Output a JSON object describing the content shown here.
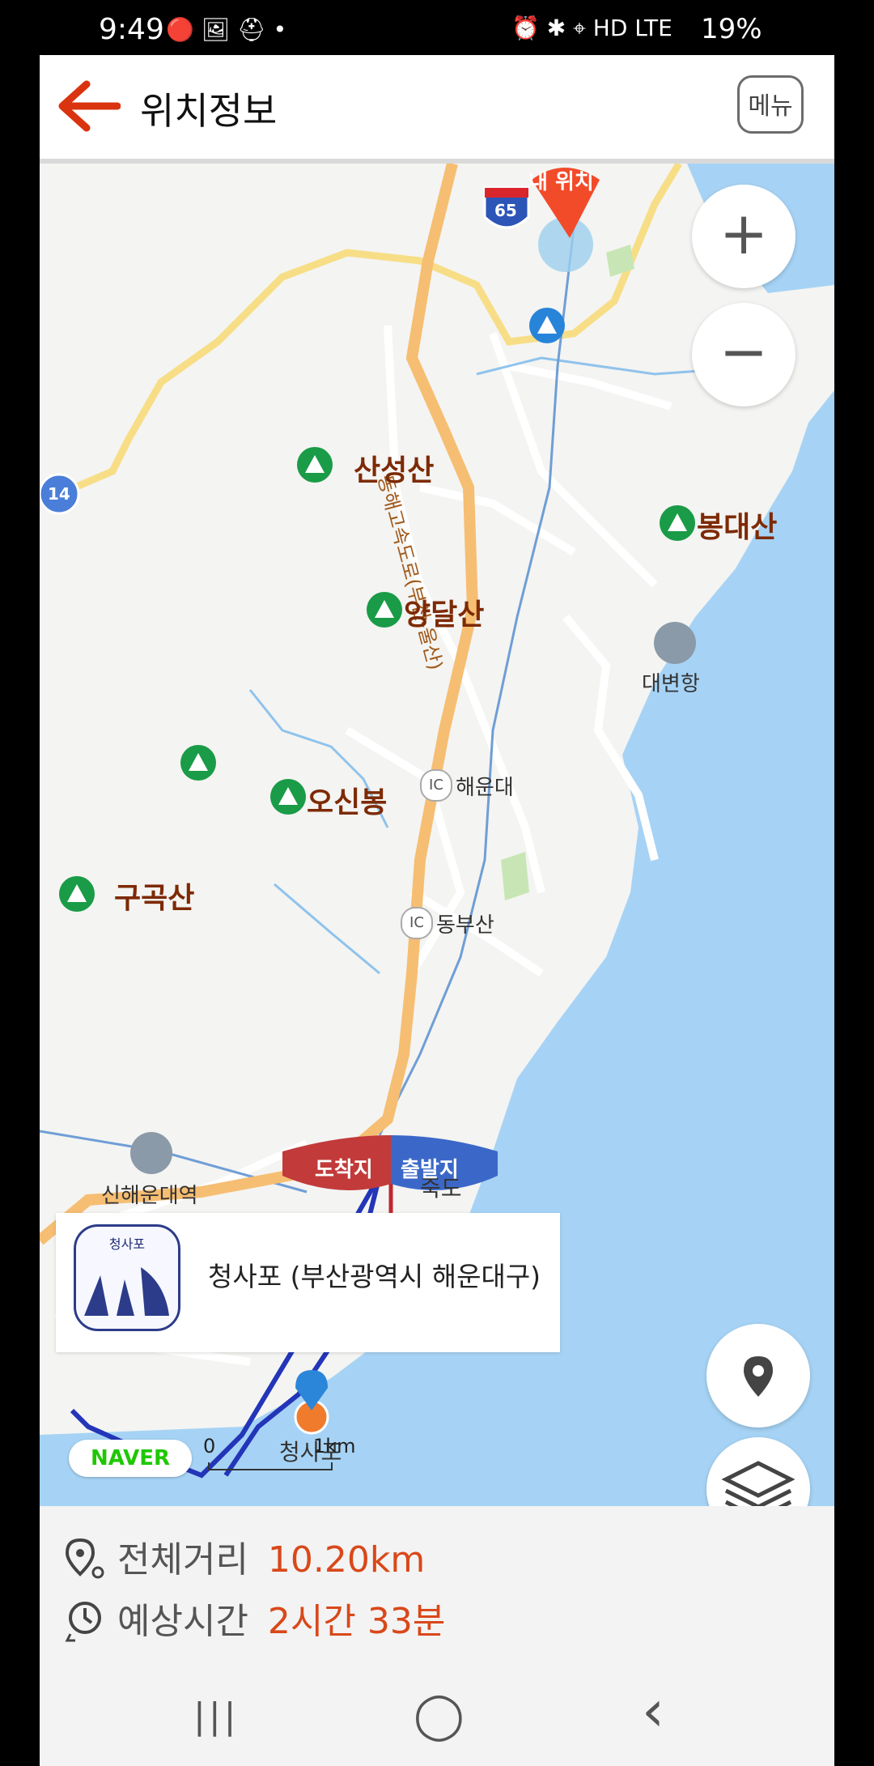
{
  "status_bar": {
    "time": "9:49",
    "left_icons": "🔴 🖼 ⛑ •",
    "right_icons": "⏰ ✱ ⌖ HD LTE",
    "battery": "19%"
  },
  "header": {
    "title": "위치정보",
    "menu_label": "메뉴",
    "accent_color": "#d9340f"
  },
  "map": {
    "my_location_label": "내 위치",
    "highway_shields": [
      "65",
      "14"
    ],
    "road_label": "동해고속도로(부산-울산)",
    "mountains": [
      "산성산",
      "봉대산",
      "양달산",
      "오신봉",
      "구곡산"
    ],
    "ports": [
      "대변항"
    ],
    "interchanges": [
      {
        "badge": "IC",
        "name": "해운대"
      },
      {
        "badge": "IC",
        "name": "동부산"
      }
    ],
    "stations": [
      "신해운대역"
    ],
    "places": [
      "죽도",
      "청사포"
    ],
    "flag_arrival": "도착지",
    "flag_departure": "출발지",
    "controls": {
      "zoom_in": "+",
      "zoom_out": "−"
    },
    "info_card": {
      "logo_text": "청사포",
      "text": "청사포 (부산광역시 해운대구)"
    },
    "naver_logo": "NAVER",
    "scale": {
      "start": "0",
      "end": "1km"
    }
  },
  "route_info": {
    "distance_label": "전체거리",
    "distance_value": "10.20km",
    "time_label": "예상시간",
    "time_value": "2시간 33분"
  },
  "nav_bar": {
    "recent": "|||",
    "home": "◯",
    "back": "‹"
  }
}
